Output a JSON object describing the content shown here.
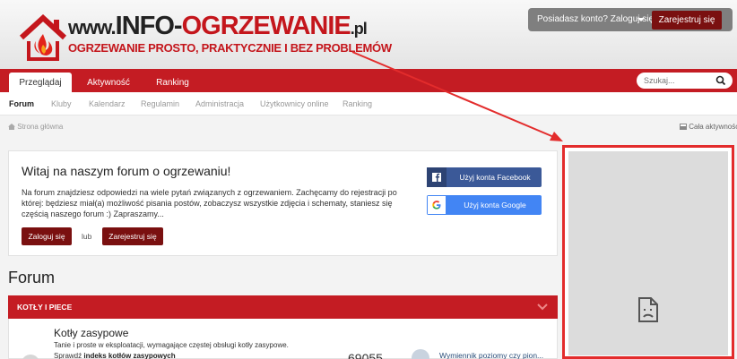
{
  "header": {
    "logo": {
      "www": "www.",
      "brand_a": "INFO-",
      "brand_b": "OGRZEWANIE",
      "tld": ".pl",
      "tagline": "OGRZEWANIE PROSTO, PRAKTYCZNIE I BEZ PROBLEMÓW"
    },
    "account_prompt": "Posiadasz konto? Zaloguj się",
    "register_label": "Zarejestruj się"
  },
  "main_nav": {
    "tabs": [
      {
        "label": "Przeglądaj",
        "active": true
      },
      {
        "label": "Aktywność",
        "active": false
      },
      {
        "label": "Ranking",
        "active": false
      }
    ],
    "search_placeholder": "Szukaj..."
  },
  "sub_nav": {
    "items": [
      {
        "label": "Forum",
        "active": true
      },
      {
        "label": "Kluby"
      },
      {
        "label": "Kalendarz"
      },
      {
        "label": "Regulamin"
      },
      {
        "label": "Administracja"
      },
      {
        "label": "Użytkownicy online"
      },
      {
        "label": "Ranking"
      }
    ]
  },
  "breadcrumb": {
    "home": "Strona główna",
    "activity": "Cała aktywność"
  },
  "welcome": {
    "title": "Witaj na naszym forum o ogrzewaniu!",
    "text": "Na forum znajdziesz odpowiedzi na wiele pytań związanych z ogrzewaniem. Zachęcamy do rejestracji po której: będziesz miał(a) możliwość pisania postów, zobaczysz wszystkie zdjęcia i schematy, staniesz się częścią naszego forum :) Zapraszamy...",
    "login_label": "Zaloguj się",
    "or_label": "lub",
    "register_label": "Zarejestruj się",
    "facebook_label": "Użyj konta Facebook",
    "google_label": "Użyj konta Google"
  },
  "forum": {
    "heading": "Forum",
    "category": "KOTŁY I PIECE",
    "row": {
      "name": "Kotły zasypowe",
      "description": "Tanie i proste w eksploatacji, wymagające częstej obsługi kotły zasypowe.",
      "desc2_prefix": "Sprawdź",
      "desc2_link": "indeks kotłów zasypowych",
      "count": "69055",
      "last_post_title": "Wymiennik poziomy czy pion..."
    }
  },
  "colors": {
    "accent_red": "#c41c23",
    "dark_red": "#7a1010",
    "facebook": "#3b5998",
    "google": "#4285f4",
    "annotation_red": "#e32c2c"
  }
}
